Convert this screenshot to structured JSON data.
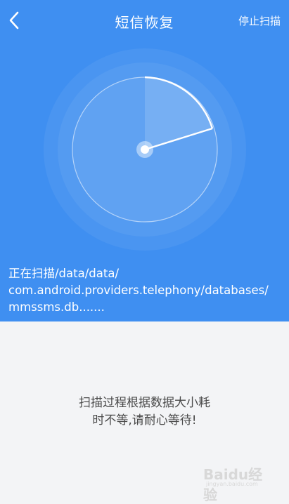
{
  "header": {
    "back_icon": "chevron-left-icon",
    "title": "短信恢复",
    "stop_label": "停止扫描"
  },
  "scan": {
    "line1": "正在扫描/data/data/",
    "line2": "com.android.providers.telephony/databases/",
    "line3": "mmssms.db......."
  },
  "hint": {
    "line1": "扫描过程根据数据大小耗",
    "line2": "时不等,请耐心等待!"
  },
  "watermark": {
    "text": "Baidu经验",
    "sub": "jingyan.baidu.com"
  },
  "colors": {
    "primary": "#3f8ff1",
    "background": "#f3f4f6",
    "hint_text": "#4a4a4a"
  }
}
